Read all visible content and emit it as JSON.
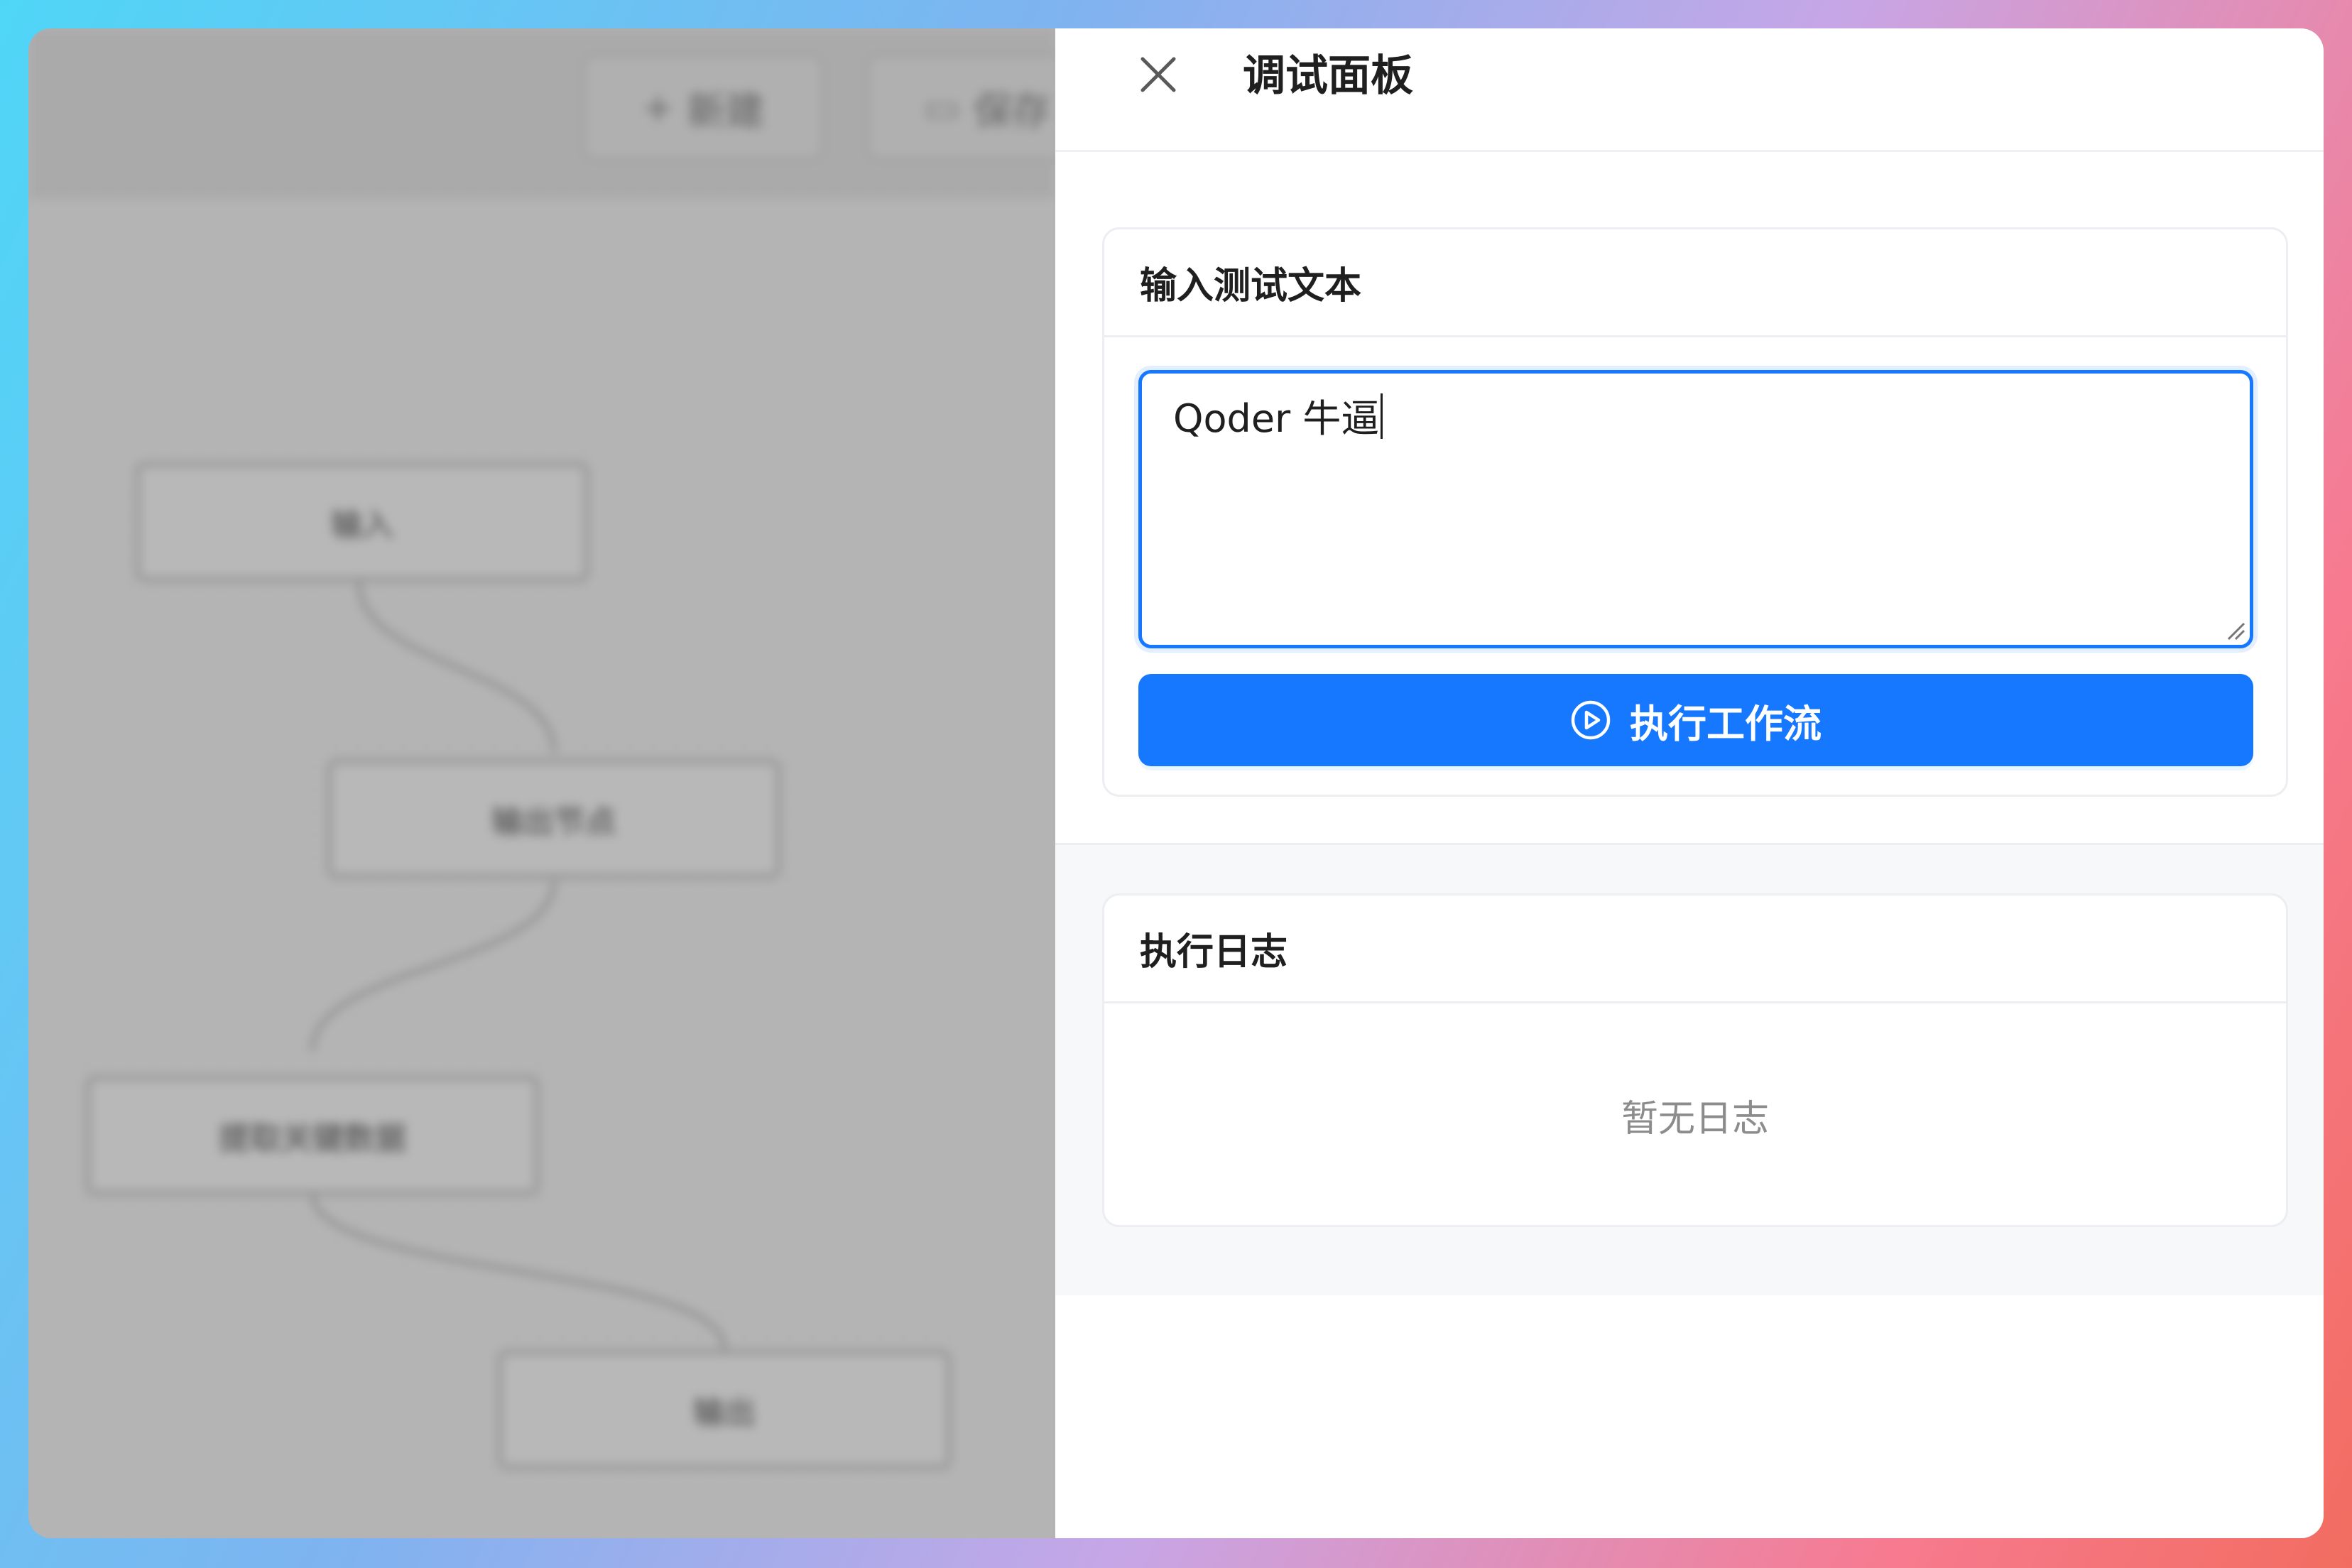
{
  "canvas": {
    "toolbar": [
      {
        "icon": "plus-icon",
        "label": "新建"
      },
      {
        "icon": "save-icon",
        "label": "保存"
      }
    ],
    "nodes": [
      "输入",
      "输出节点",
      "提取关键数据",
      "输出"
    ]
  },
  "drawer": {
    "title": "调试面板",
    "input_section": {
      "title": "输入测试文本",
      "value": "Qoder 牛逼",
      "run_label": "执行工作流"
    },
    "log_section": {
      "title": "执行日志",
      "empty_text": "暂无日志"
    }
  },
  "colors": {
    "primary": "#1677ff",
    "muted_text": "#8c8c8c",
    "overlay": "#b3b3b3"
  }
}
